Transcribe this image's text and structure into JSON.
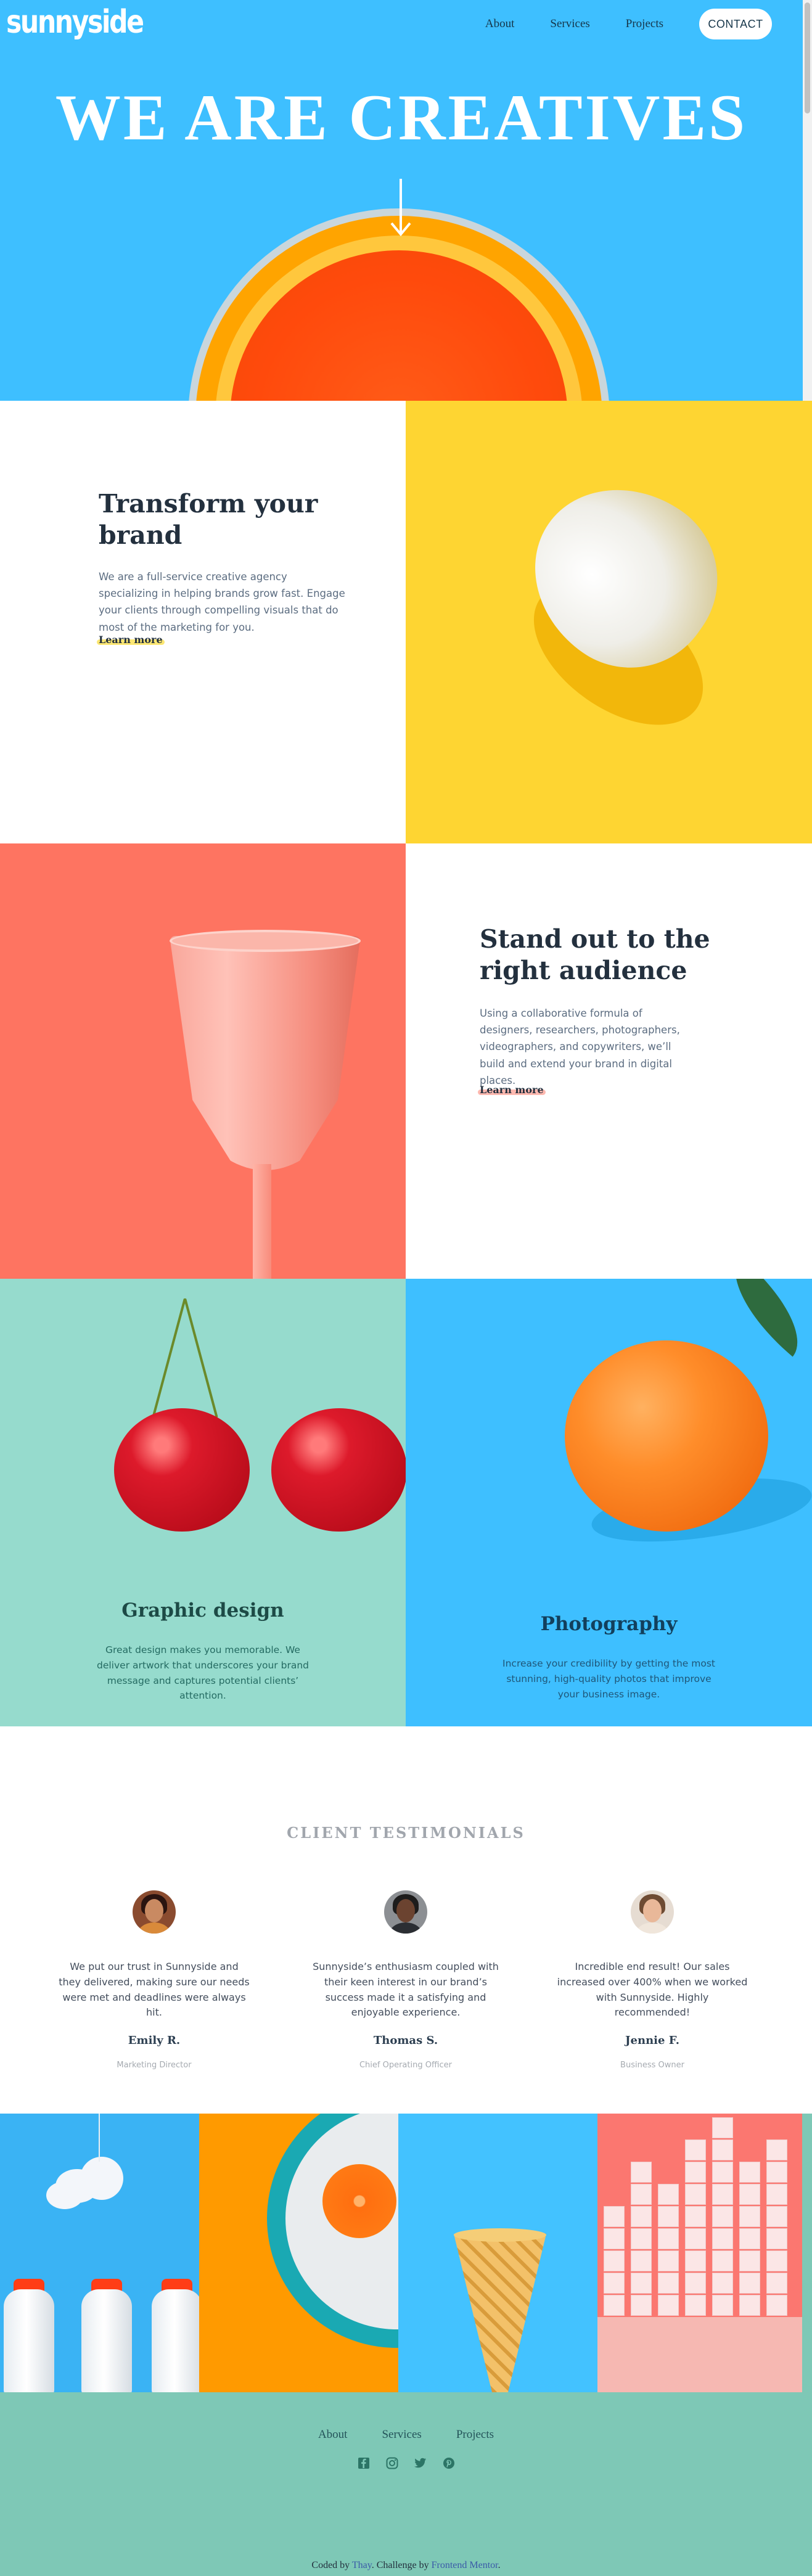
{
  "brand": {
    "logo": "sunnyside"
  },
  "nav": {
    "about": "About",
    "services": "Services",
    "projects": "Projects",
    "contact": "CONTACT"
  },
  "hero": {
    "title": "WE ARE CREATIVES"
  },
  "transform": {
    "title": "Transform your brand",
    "text": "We are a full-service creative agency specializing in helping brands grow fast. Engage your clients through compelling visuals that do most of the marketing for you.",
    "link": "Learn more"
  },
  "standout": {
    "title": "Stand out to the right audience",
    "text": "Using a collaborative formula of designers, researchers, photographers, videographers, and copywriters, we’ll build and extend your brand in digital places.",
    "link": "Learn more"
  },
  "services": {
    "design": {
      "title": "Graphic design",
      "text": "Great design makes you memorable. We deliver artwork that underscores your brand message and captures potential clients’ attention."
    },
    "photo": {
      "title": "Photography",
      "text": "Increase your credibility by getting the most stunning, high-quality photos that improve your business image."
    }
  },
  "testimonials": {
    "heading": "CLIENT TESTIMONIALS",
    "items": [
      {
        "quote": "We put our trust in Sunnyside and they delivered, making sure our needs were met and deadlines were always hit.",
        "name": "Emily R.",
        "role": "Marketing Director"
      },
      {
        "quote": "Sunnyside’s enthusiasm coupled with their keen interest in our brand’s success made it a satisfying and enjoyable experience.",
        "name": "Thomas S.",
        "role": "Chief Operating Officer"
      },
      {
        "quote": "Incredible end result! Our sales increased over 400% when we worked with Sunnyside. Highly recommended!",
        "name": "Jennie F.",
        "role": "Business Owner"
      }
    ]
  },
  "footer": {
    "nav": {
      "about": "About",
      "services": "Services",
      "projects": "Projects"
    },
    "socials": [
      "facebook-icon",
      "instagram-icon",
      "twitter-icon",
      "pinterest-icon"
    ],
    "credit_prefix": "Coded by",
    "credit_author": "Thay",
    "credit_middle": ". Challenge by",
    "credit_source": "Frontend Mentor",
    "credit_end": "."
  },
  "colors": {
    "hero_blue": "#3ebfff",
    "yellow": "#fed532",
    "salmon": "#fe7461",
    "mint": "#96dbcd",
    "footer_green": "#7ec8b6",
    "dark_text": "#23303e"
  }
}
